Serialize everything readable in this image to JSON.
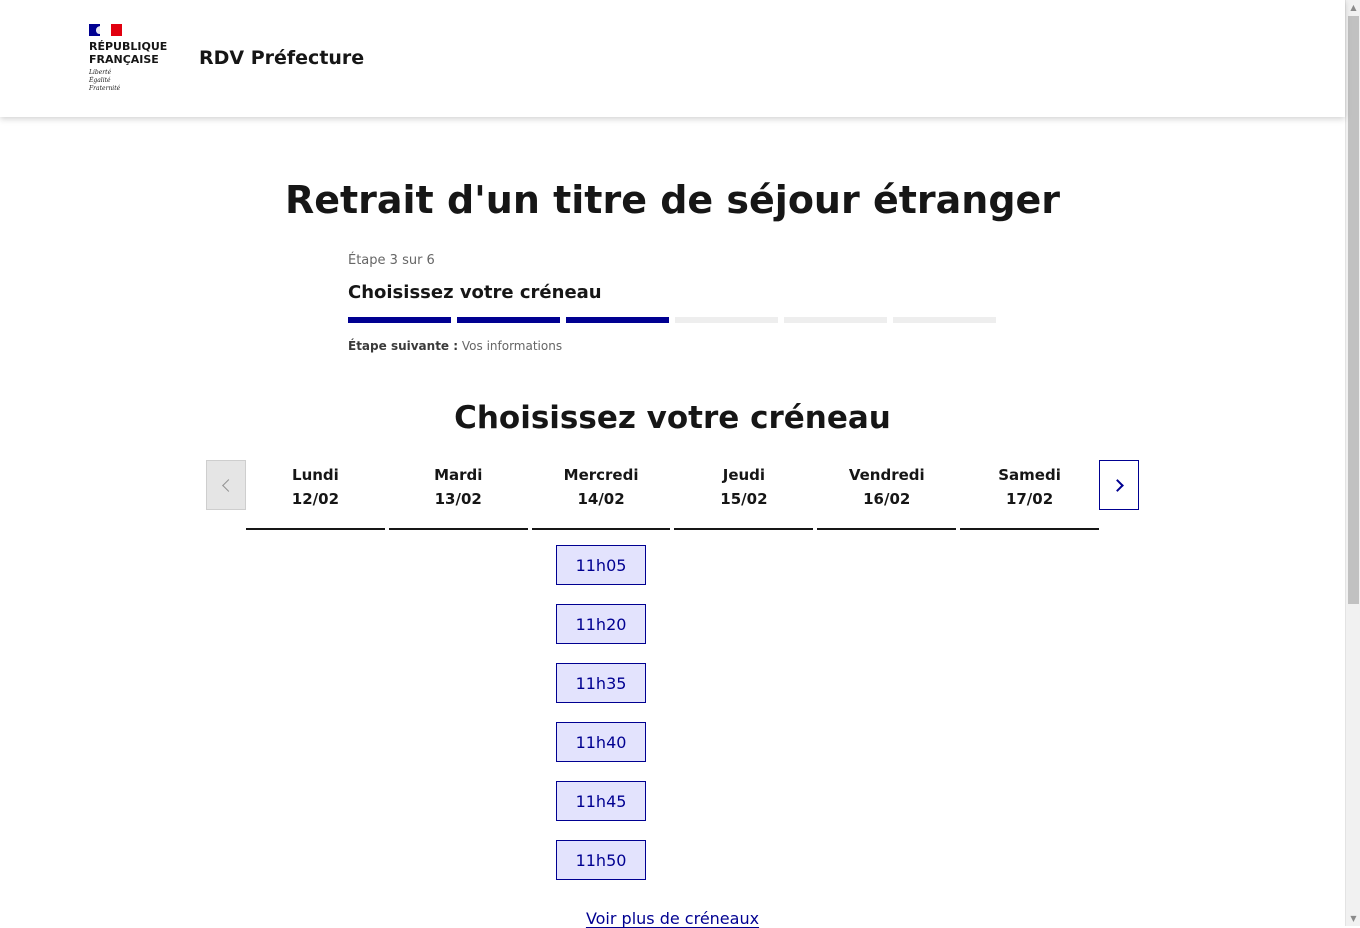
{
  "header": {
    "logo_text": "RÉPUBLIQUE FRANÇAISE",
    "logo_motto": [
      "Liberté",
      "Égalité",
      "Fraternité"
    ],
    "service_name": "RDV Préfecture"
  },
  "main": {
    "title": "Retrait d'un titre de séjour étranger"
  },
  "stepper": {
    "state": "Étape 3 sur 6",
    "title": "Choisissez votre créneau",
    "current_step": 3,
    "total_steps": 6,
    "next_label": "Étape suivante :",
    "next_value": "Vos informations"
  },
  "calendar": {
    "title": "Choisissez votre créneau",
    "days": [
      {
        "name": "Lundi",
        "date": "12/02"
      },
      {
        "name": "Mardi",
        "date": "13/02"
      },
      {
        "name": "Mercredi",
        "date": "14/02"
      },
      {
        "name": "Jeudi",
        "date": "15/02"
      },
      {
        "name": "Vendredi",
        "date": "16/02"
      },
      {
        "name": "Samedi",
        "date": "17/02"
      }
    ],
    "slots": [
      "11h05",
      "11h20",
      "11h35",
      "11h40",
      "11h45",
      "11h50"
    ],
    "more_label": "Voir plus de créneaux",
    "prev_icon": "chevron-left-icon",
    "next_icon": "chevron-right-icon"
  },
  "colors": {
    "primary": "#000091",
    "slot_background": "#e3e3fd",
    "progress_inactive": "#eeeeee",
    "flag_red": "#e1000f"
  }
}
